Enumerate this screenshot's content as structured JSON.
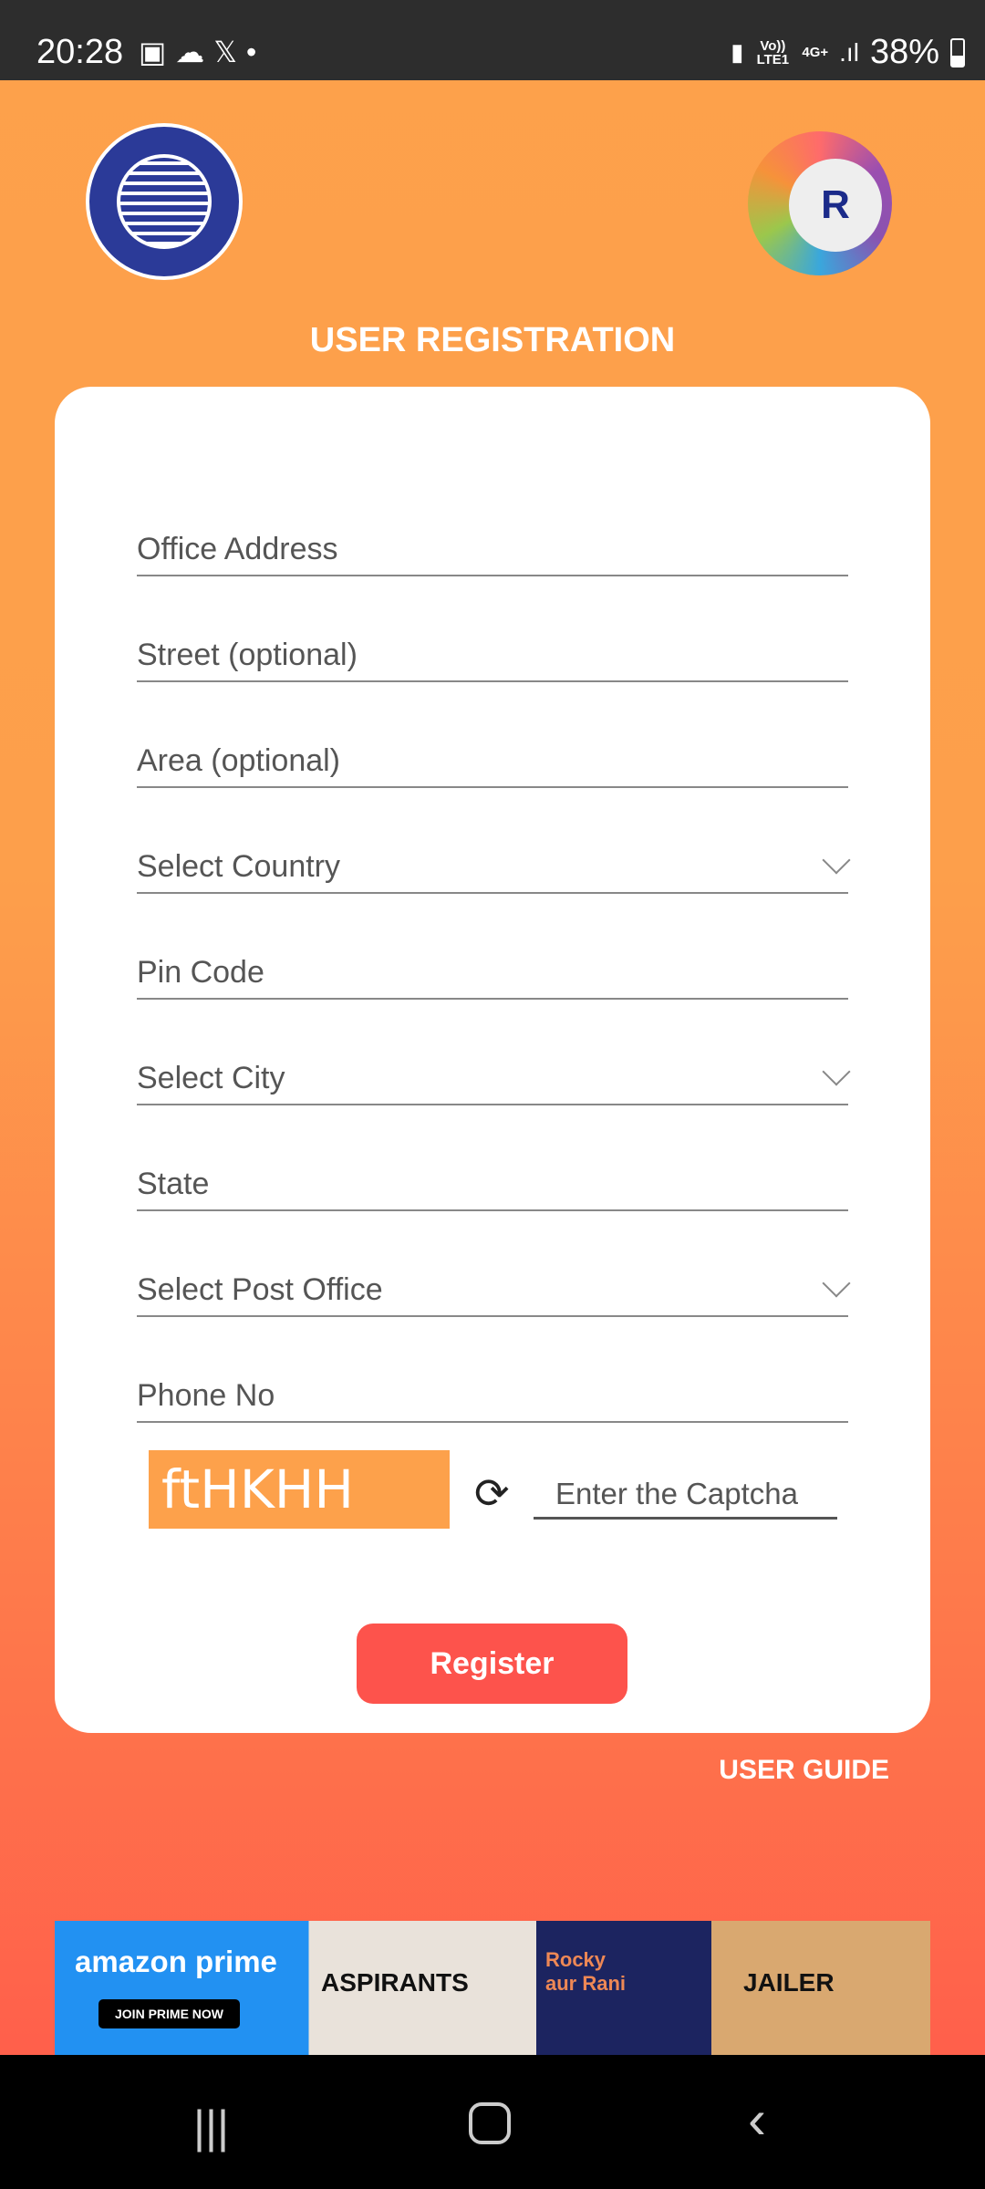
{
  "status_bar": {
    "time": "20:28",
    "battery": "38%",
    "network": "4G+",
    "carrier": "Vo)) LTE1",
    "notification_icons": [
      "image-icon",
      "cloud-icon",
      "x-icon",
      "dot-icon"
    ]
  },
  "header": {
    "title": "USER REGISTRATION",
    "left_logo": "INDIAN RAILWAYS",
    "right_logo": "IRCTC"
  },
  "form": {
    "fields": [
      {
        "label": "Office Address",
        "dropdown": false
      },
      {
        "label": "Street (optional)",
        "dropdown": false
      },
      {
        "label": "Area (optional)",
        "dropdown": false
      },
      {
        "label": "Select Country",
        "dropdown": true
      },
      {
        "label": "Pin Code",
        "dropdown": false
      },
      {
        "label": "Select City",
        "dropdown": true
      },
      {
        "label": "State",
        "dropdown": false
      },
      {
        "label": "Select Post Office",
        "dropdown": true
      },
      {
        "label": "Phone No",
        "dropdown": false
      }
    ],
    "captcha": {
      "text": "ftHKHH",
      "placeholder": "Enter the Captcha"
    },
    "register_label": "Register"
  },
  "user_guide": "USER GUIDE",
  "ad": {
    "brand": "amazon prime",
    "cta": "JOIN PRIME NOW",
    "titles": [
      "ASPIRANTS",
      "Rocky aur Rani",
      "JAILER"
    ]
  },
  "colors": {
    "accent_orange": "#fda14b",
    "register_button": "#fd534c",
    "bottom_gradient": "#ff5e4b"
  }
}
